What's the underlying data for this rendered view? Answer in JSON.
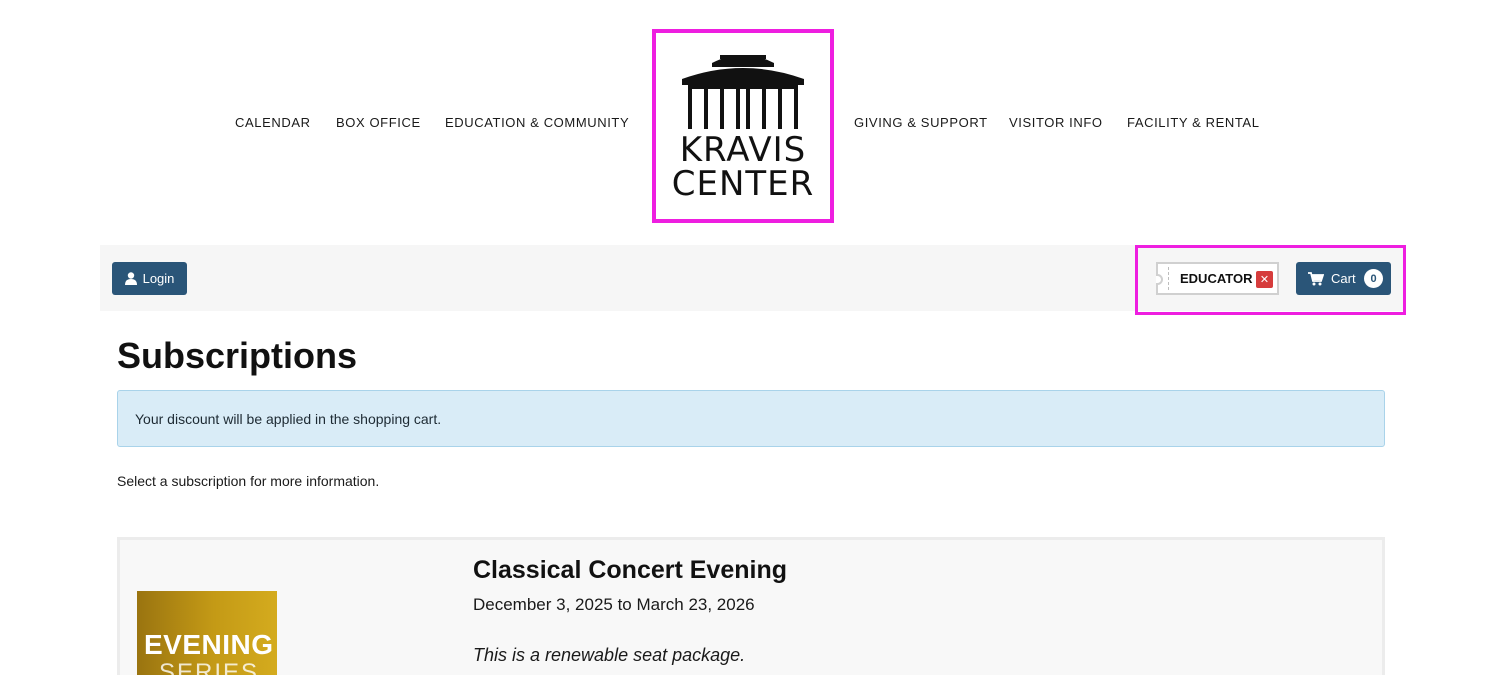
{
  "nav": {
    "left": [
      "CALENDAR",
      "BOX OFFICE",
      "EDUCATION & COMMUNITY"
    ],
    "right": [
      "GIVING & SUPPORT",
      "VISITOR INFO",
      "FACILITY & RENTAL"
    ]
  },
  "logo": {
    "line1": "KRAVIS",
    "line2": "CENTER"
  },
  "account": {
    "login_label": "Login",
    "promo_code": "EDUCATOR",
    "remove_symbol": "✕",
    "cart_label": "Cart",
    "cart_count": "0"
  },
  "page": {
    "title": "Subscriptions",
    "alert": "Your discount will be applied in the shopping cart.",
    "helper": "Select a subscription for more information."
  },
  "subscription": {
    "image_line1": "EVENING",
    "image_line2": "SERIES",
    "title": "Classical Concert Evening",
    "dates": "December 3, 2025 to March 23, 2026",
    "note": "This is a renewable seat package."
  },
  "colors": {
    "accent": "#2a5578",
    "highlight": "#ee1ee0",
    "alert_bg": "#d9ecf7",
    "remove": "#d63c3c"
  },
  "icons": [
    "user-icon",
    "cart-icon",
    "close-icon",
    "theater-building-icon"
  ]
}
